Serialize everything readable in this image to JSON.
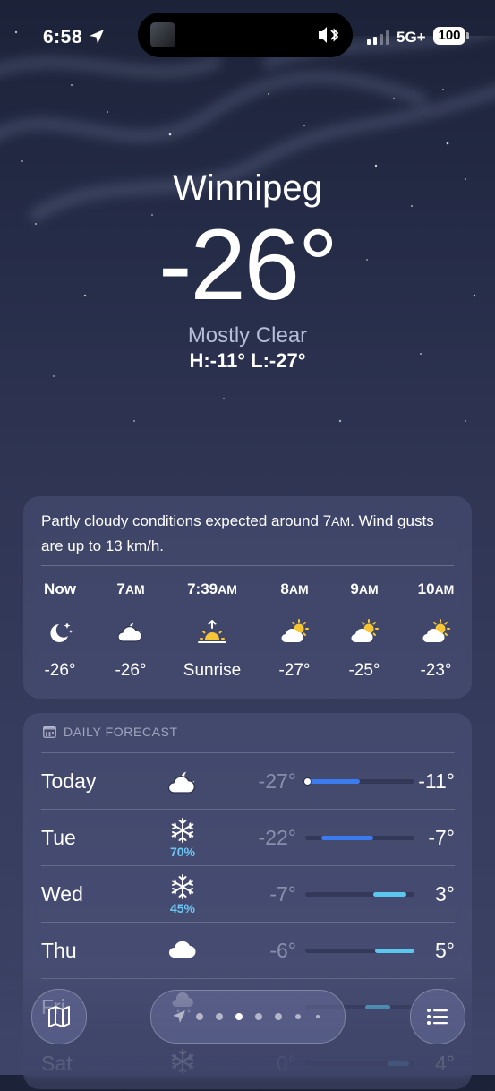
{
  "status_bar": {
    "time": "6:58",
    "network": "5G+",
    "battery": "100"
  },
  "location": {
    "city": "Winnipeg",
    "temperature": "-26°",
    "condition": "Mostly Clear",
    "high_low": "H:-11°  L:-27°"
  },
  "hourly": {
    "summary_a": "Partly cloudy conditions expected around 7",
    "summary_ampm": "AM",
    "summary_b": ". Wind gusts are up to 13 km/h.",
    "hours": [
      {
        "time": "Now",
        "suffix": "",
        "icon": "moon-stars-icon",
        "value": "-26°"
      },
      {
        "time": "7",
        "suffix": "AM",
        "icon": "cloud-moon-icon",
        "value": "-26°"
      },
      {
        "time": "7:39",
        "suffix": "AM",
        "icon": "sunrise-icon",
        "value": "Sunrise"
      },
      {
        "time": "8",
        "suffix": "AM",
        "icon": "cloud-sun-icon",
        "value": "-27°"
      },
      {
        "time": "9",
        "suffix": "AM",
        "icon": "cloud-sun-icon",
        "value": "-25°"
      },
      {
        "time": "10",
        "suffix": "AM",
        "icon": "cloud-sun-icon",
        "value": "-23°"
      }
    ]
  },
  "daily": {
    "header": "DAILY FORECAST",
    "header_icon": "calendar-icon",
    "days": [
      {
        "day": "Today",
        "icon": "cloud-moon-icon",
        "precip": "",
        "low": "-27°",
        "high": "-11°",
        "range_start": 0.0,
        "range_end": 0.5,
        "current": 0.0
      },
      {
        "day": "Tue",
        "icon": "snowflake-icon",
        "precip": "70%",
        "low": "-22°",
        "high": "-7°",
        "range_start": 0.15,
        "range_end": 0.62
      },
      {
        "day": "Wed",
        "icon": "snowflake-icon",
        "precip": "45%",
        "low": "-7°",
        "high": "3°",
        "range_start": 0.62,
        "range_end": 0.93
      },
      {
        "day": "Thu",
        "icon": "cloud-icon",
        "precip": "",
        "low": "-6°",
        "high": "5°",
        "range_start": 0.64,
        "range_end": 1.0
      },
      {
        "day": "Fri",
        "icon": "cloud-snow-icon",
        "precip": "",
        "low": "",
        "high": "",
        "range_start": 0.55,
        "range_end": 0.78
      },
      {
        "day": "Sat",
        "icon": "snowflake-icon",
        "precip": "",
        "low": "0°",
        "high": "4°",
        "range_start": 0.75,
        "range_end": 0.95
      }
    ]
  },
  "toolbar": {
    "map_icon": "map-icon",
    "list_icon": "list-icon",
    "page_count": 7,
    "active_page": 2
  }
}
